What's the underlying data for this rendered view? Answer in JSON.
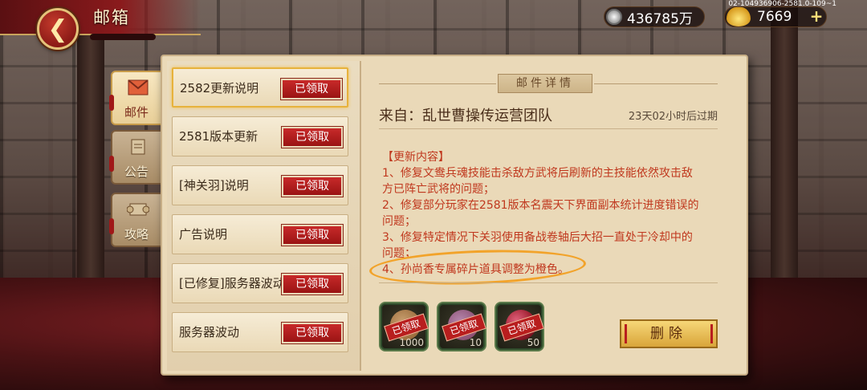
{
  "header": {
    "title": "邮箱",
    "back_icon": "chevron-left-icon",
    "silver": "436785万",
    "gold": "7669",
    "plus_label": "+",
    "build_id": "02-104936906-2581.0-109~1"
  },
  "tabs": [
    {
      "label": "邮件",
      "icon": "mail-icon",
      "active": true
    },
    {
      "label": "公告",
      "icon": "notice-icon",
      "active": false
    },
    {
      "label": "攻略",
      "icon": "scroll-icon",
      "active": false
    }
  ],
  "mail_list": [
    {
      "subject": "2582更新说明",
      "status": "已领取",
      "selected": true
    },
    {
      "subject": "2581版本更新",
      "status": "已领取",
      "selected": false
    },
    {
      "subject": "[神关羽]说明",
      "status": "已领取",
      "selected": false
    },
    {
      "subject": "广告说明",
      "status": "已领取",
      "selected": false
    },
    {
      "subject": "[已修复]服务器波动",
      "status": "已领取",
      "selected": false
    },
    {
      "subject": "服务器波动",
      "status": "已领取",
      "selected": false
    }
  ],
  "detail": {
    "header": "邮件详情",
    "from": "来自：乱世曹操传运营团队",
    "expire": "23天02小时后过期",
    "body": "【更新内容】\n1、修复文鸯兵魂技能击杀敌方武将后刷新的主技能依然攻击敌方已阵亡武将的问题；\n2、修复部分玩家在2581版本名震天下界面副本统计进度错误的问题；\n3、修复特定情况下关羽使用备战卷轴后大招一直处于冷却中的问题；\n4、孙尚香专属碎片道具调整为橙色。",
    "attachments": [
      {
        "stamp": "已领取",
        "qty": "1000",
        "icon": "silver-pouch-icon",
        "color": "#8a5a2a"
      },
      {
        "stamp": "已领取",
        "qty": "10",
        "icon": "treasure-bag-icon",
        "color": "#7a3a5a"
      },
      {
        "stamp": "已领取",
        "qty": "50",
        "icon": "red-orb-icon",
        "color": "#9a1a2a"
      }
    ],
    "delete_label": "删除"
  }
}
